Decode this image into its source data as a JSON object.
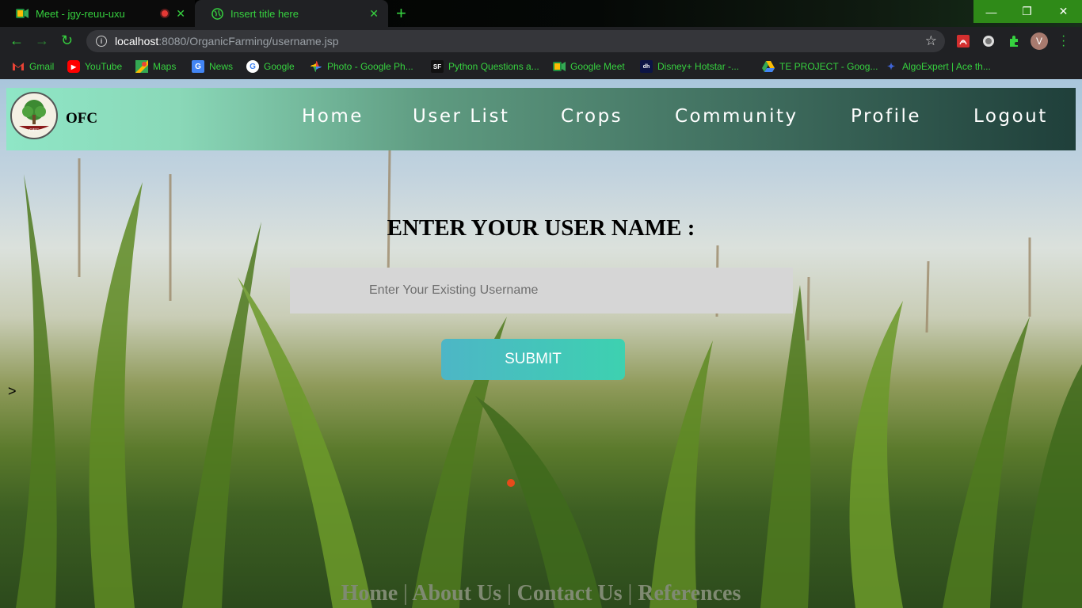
{
  "browser": {
    "tabs": [
      {
        "title": "Meet - jgy-reuu-uxu"
      },
      {
        "title": "Insert title here"
      }
    ],
    "url": {
      "host": "localhost",
      "path": ":8080/OrganicFarming/username.jsp"
    },
    "avatar_letter": "V",
    "bookmarks": [
      {
        "label": "Gmail",
        "icon": "gmail-icon"
      },
      {
        "label": "YouTube",
        "icon": "youtube-icon"
      },
      {
        "label": "Maps",
        "icon": "maps-icon"
      },
      {
        "label": "News",
        "icon": "news-icon"
      },
      {
        "label": "Google",
        "icon": "google-icon"
      },
      {
        "label": "Photo - Google Ph...",
        "icon": "photos-icon"
      },
      {
        "label": "Python Questions a...",
        "icon": "sf-icon"
      },
      {
        "label": "Google Meet",
        "icon": "meet-icon"
      },
      {
        "label": "Disney+ Hotstar -...",
        "icon": "hotstar-icon"
      },
      {
        "label": "TE PROJECT - Goog...",
        "icon": "drive-icon"
      },
      {
        "label": "AlgoExpert | Ace th...",
        "icon": "algoexpert-icon"
      }
    ],
    "accent_color": "#36d13f"
  },
  "site": {
    "brand": "OFC",
    "logo_text": "OFC",
    "nav": [
      "Home",
      "User List",
      "Crops",
      "Community",
      "Profile",
      "Logout"
    ]
  },
  "form": {
    "heading": "ENTER YOUR USER NAME :",
    "username_value": "",
    "username_placeholder": "Enter Your Existing Username",
    "submit_label": "SUBMIT"
  },
  "stray_text": ">",
  "footer": {
    "links": [
      "Home",
      "About Us",
      "Contact Us",
      "References"
    ],
    "separator": "|"
  }
}
